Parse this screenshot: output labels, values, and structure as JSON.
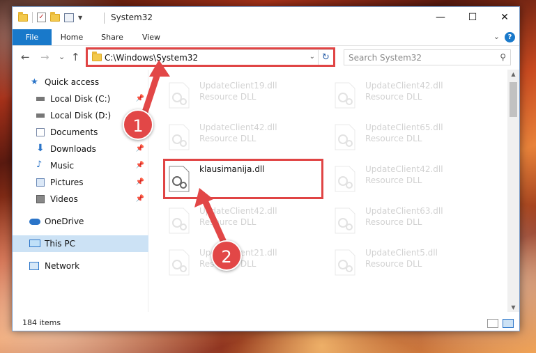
{
  "window": {
    "title": "System32",
    "controls": {
      "minimize": "—",
      "maximize": "☐",
      "close": "✕"
    }
  },
  "ribbon": {
    "tabs": [
      "File",
      "Home",
      "Share",
      "View"
    ],
    "help": "?"
  },
  "navigation": {
    "back": "←",
    "forward": "→",
    "recent": "⌄",
    "up": "↑"
  },
  "address_bar": {
    "path": "C:\\Windows\\System32",
    "refresh": "↻"
  },
  "search": {
    "placeholder": "Search System32",
    "icon": "⚲"
  },
  "nav_pane": {
    "items": [
      {
        "label": "Quick access",
        "icon": "star-icon"
      },
      {
        "label": "Local Disk (C:)",
        "icon": "drive-icon",
        "pinned": true
      },
      {
        "label": "Local Disk (D:)",
        "icon": "drive-icon"
      },
      {
        "label": "Documents",
        "icon": "document-icon",
        "pinned": true
      },
      {
        "label": "Downloads",
        "icon": "download-icon",
        "pinned": true
      },
      {
        "label": "Music",
        "icon": "music-icon",
        "pinned": true
      },
      {
        "label": "Pictures",
        "icon": "pictures-icon",
        "pinned": true
      },
      {
        "label": "Videos",
        "icon": "videos-icon",
        "pinned": true
      },
      {
        "label": "OneDrive",
        "icon": "cloud-icon"
      },
      {
        "label": "This PC",
        "icon": "pc-icon",
        "selected": true
      },
      {
        "label": "Network",
        "icon": "network-icon"
      }
    ],
    "pin_glyph": "📌"
  },
  "files": [
    {
      "name": "UpdateClient19.dll",
      "type": "Resource DLL"
    },
    {
      "name": "UpdateClient42.dll",
      "type": "Resource DLL"
    },
    {
      "name": "UpdateClient42.dll",
      "type": "Resource DLL"
    },
    {
      "name": "UpdateClient65.dll",
      "type": "Resource DLL"
    },
    {
      "name": "klausimanija.dll",
      "type": ""
    },
    {
      "name": "UpdateClient42.dll",
      "type": "Resource DLL"
    },
    {
      "name": "UpdateClient42.dll",
      "type": "Resource DLL"
    },
    {
      "name": "UpdateClient63.dll",
      "type": "Resource DLL"
    },
    {
      "name": "UpdateClient21.dll",
      "type": "Resource DLL"
    },
    {
      "name": "UpdateClient5.dll",
      "type": "Resource DLL"
    }
  ],
  "status": {
    "item_count": "184 items"
  },
  "callouts": [
    "1",
    "2"
  ],
  "colors": {
    "accent": "#1979ca",
    "highlight": "#e04444",
    "selected": "#cce2f5",
    "callout": "#e24747"
  }
}
